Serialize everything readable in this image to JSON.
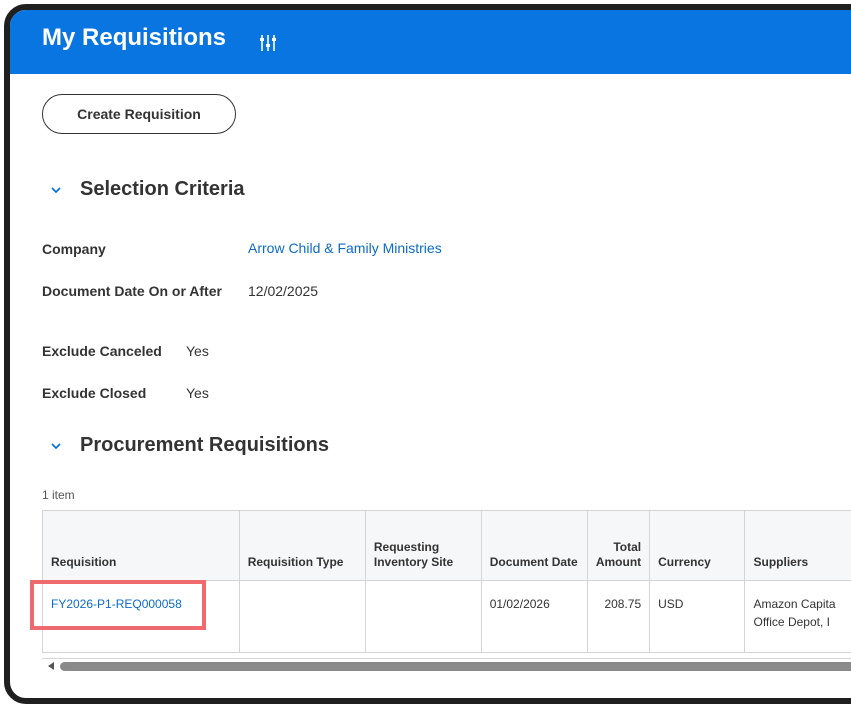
{
  "header": {
    "title": "My Requisitions",
    "filter_icon": "sliders-icon",
    "background": "#0875e1"
  },
  "actions": {
    "create_label": "Create Requisition"
  },
  "selection_criteria": {
    "title": "Selection Criteria",
    "fields": {
      "company": {
        "label": "Company",
        "value": "Arrow Child & Family Ministries"
      },
      "document_date": {
        "label": "Document Date On or After",
        "value": "12/02/2025"
      },
      "exclude_canceled": {
        "label": "Exclude Canceled",
        "value": "Yes"
      },
      "exclude_closed": {
        "label": "Exclude Closed",
        "value": "Yes"
      }
    }
  },
  "procurement": {
    "title": "Procurement Requisitions",
    "count": "1 item",
    "columns": [
      "Requisition",
      "Requisition Type",
      "Requesting Inventory Site",
      "Document Date",
      "Total Amount",
      "Currency",
      "Suppliers"
    ],
    "rows": [
      {
        "requisition": "FY2026-P1-REQ000058",
        "requisition_type": "",
        "inventory_site": "",
        "document_date": "01/02/2026",
        "total_amount": "208.75",
        "currency": "USD",
        "suppliers": [
          "Amazon Capita",
          "Office Depot, I"
        ]
      }
    ]
  },
  "colors": {
    "link": "#0b6cc7",
    "highlight": "#ee6a6f"
  }
}
